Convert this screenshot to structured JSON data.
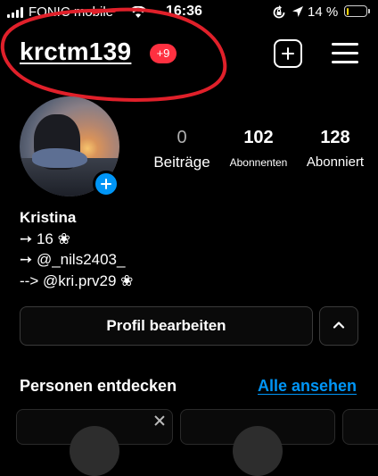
{
  "status_bar": {
    "carrier": "FONIC mobile",
    "time": "16:36",
    "battery_percent_text": "14 %",
    "battery_level": 0.14,
    "battery_color": "#ffd60a",
    "icons": [
      "signal-icon",
      "wifi-icon",
      "rotation-lock-icon",
      "location-icon",
      "battery-icon"
    ]
  },
  "header": {
    "username": "krctm139",
    "notification_badge": "+9",
    "badge_color": "#ff3040",
    "annotation_color": "#e0202a",
    "icons": [
      "new-post-icon",
      "menu-icon"
    ]
  },
  "profile": {
    "stats": [
      {
        "value": "0",
        "label": "Beiträge"
      },
      {
        "value": "102",
        "label": "Abonnenten"
      },
      {
        "value": "128",
        "label": "Abonniert"
      }
    ]
  },
  "bio": {
    "name": "Kristina",
    "lines": [
      "➙ 16 ❀",
      "➙ @_nils2403_",
      "--> @kri.prv29 ❀"
    ]
  },
  "actions": {
    "edit_profile_label": "Profil bearbeiten",
    "accent_color": "#0095f6"
  },
  "discover": {
    "title": "Personen entdecken",
    "see_all_label": "Alle ansehen"
  }
}
